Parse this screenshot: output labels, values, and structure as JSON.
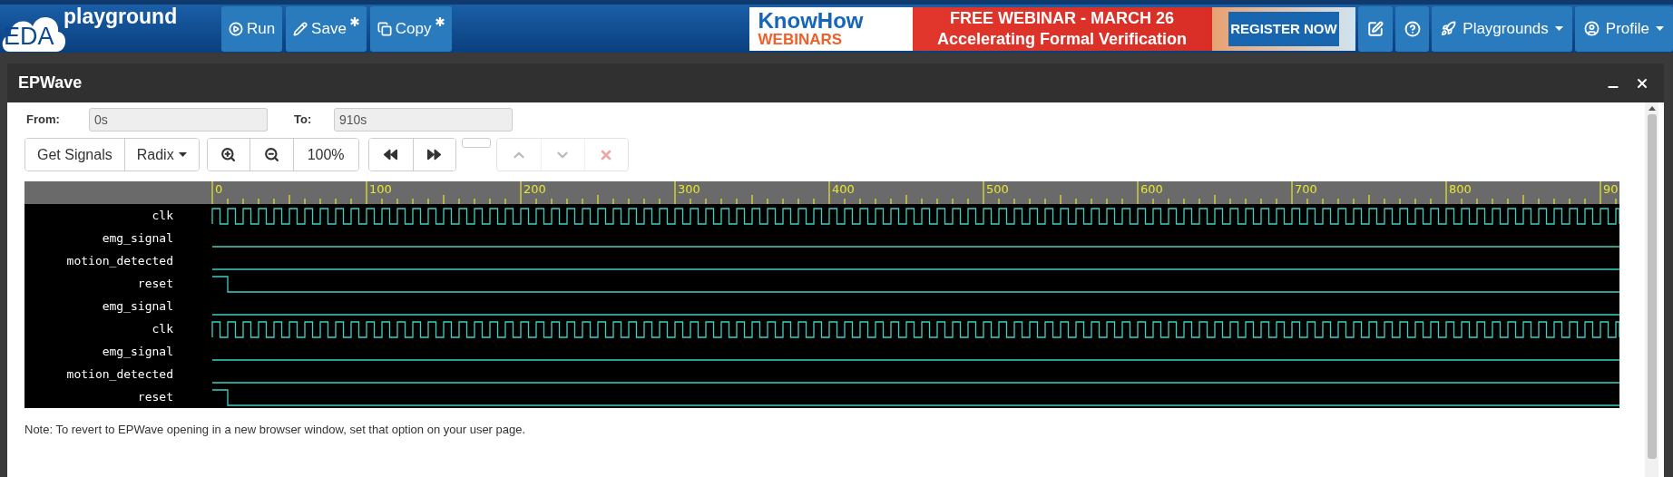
{
  "header": {
    "logo_text": "EDA",
    "brand": "playground",
    "buttons": [
      {
        "label": "Run",
        "kind": "run",
        "modified": false
      },
      {
        "label": "Save",
        "kind": "save",
        "modified": true
      },
      {
        "label": "Copy",
        "kind": "copy",
        "modified": true
      }
    ],
    "ad": {
      "brand": "KnowHow",
      "subbrand": "WEBINARS",
      "headline": "FREE WEBINAR - MARCH 26",
      "subtitle": "Accelerating Formal Verification",
      "cta": "REGISTER NOW"
    },
    "menus": [
      {
        "label": "Playgrounds",
        "kind": "rocket"
      },
      {
        "label": "Profile",
        "kind": "user"
      }
    ]
  },
  "dialog": {
    "title": "EPWave"
  },
  "range": {
    "from_label": "From:",
    "from": "0s",
    "to_label": "To:",
    "to": "910s"
  },
  "toolbar": {
    "get_signals": "Get Signals",
    "radix": "Radix",
    "zoom": "100%",
    "edit_buttons": [
      {
        "kind": "up",
        "disabled": true
      },
      {
        "kind": "down",
        "disabled": true
      },
      {
        "kind": "delete",
        "disabled": true
      }
    ]
  },
  "waves": {
    "ruler": [
      "0",
      "100",
      "200",
      "300",
      "400",
      "500",
      "600",
      "700",
      "800",
      "90"
    ],
    "signals": [
      {
        "name": "clk",
        "kind": "clock"
      },
      {
        "name": "emg_signal",
        "kind": "low"
      },
      {
        "name": "motion_detected",
        "kind": "low"
      },
      {
        "name": "reset",
        "kind": "reset"
      },
      {
        "name": "emg_signal",
        "kind": "low"
      },
      {
        "name": "clk",
        "kind": "clock"
      },
      {
        "name": "emg_signal",
        "kind": "low"
      },
      {
        "name": "motion_detected",
        "kind": "low"
      },
      {
        "name": "reset",
        "kind": "reset"
      }
    ]
  },
  "note": "Note: To revert to EPWave opening in a new browser window, set that option on your user page."
}
